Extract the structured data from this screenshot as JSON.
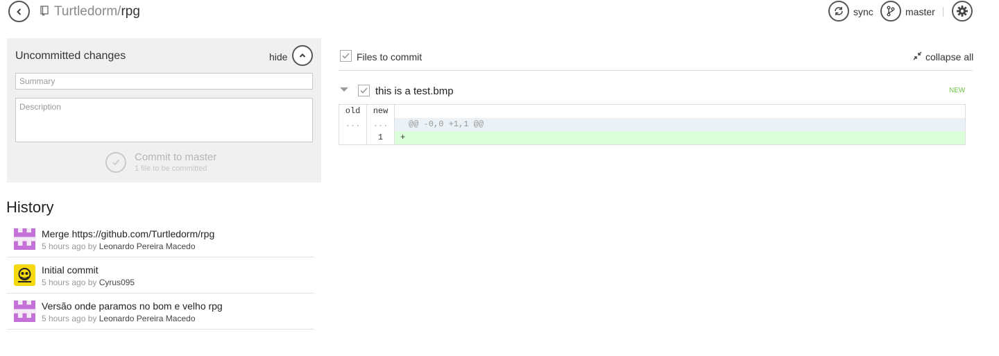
{
  "header": {
    "repo_owner": "Turtledorm/",
    "repo_name": "rpg",
    "sync_label": "sync",
    "branch_label": "master"
  },
  "commit_panel": {
    "title": "Uncommitted changes",
    "hide_label": "hide",
    "summary_placeholder": "Summary",
    "description_placeholder": "Description",
    "commit_label": "Commit to master",
    "commit_sub": "1 file to be committed"
  },
  "history": {
    "title": "History",
    "items": [
      {
        "message": "Merge https://github.com/Turtledorm/rpg",
        "time": "5 hours ago by ",
        "author": "Leonardo Pereira Macedo",
        "avatar": "pink-identicon"
      },
      {
        "message": "Initial commit",
        "time": "5 hours ago by ",
        "author": "Cyrus095",
        "avatar": "pirate-flag-avatar"
      },
      {
        "message": "Versão onde paramos no bom e velho rpg",
        "time": "5 hours ago by ",
        "author": "Leonardo Pereira Macedo",
        "avatar": "pink-identicon"
      }
    ]
  },
  "files": {
    "header_label": "Files to commit",
    "collapse_label": "collapse all",
    "file": {
      "name": "this is a test.bmp",
      "status": "NEW"
    },
    "diff": {
      "col_old": "old",
      "col_new": "new",
      "hunk_old": "...",
      "hunk_new": "...",
      "hunk_text": "@@ -0,0 +1,1 @@",
      "line_old": "",
      "line_new": "1",
      "line_text": "+"
    }
  },
  "colors": {
    "panel_bg": "#f0f0f0",
    "new_badge": "#6cc644",
    "added_line_bg": "#dbffdb",
    "hunk_bg": "#eaf2f7",
    "identicon": "#c572d8"
  }
}
